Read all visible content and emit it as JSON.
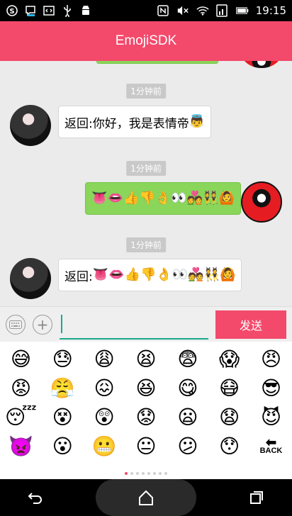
{
  "status_bar": {
    "time": "19:15",
    "left_icons": [
      "s-logo-icon",
      "chat-bubble-icon",
      "code-icon",
      "usb-icon",
      "android-icon"
    ],
    "right_icons": [
      "nfc-icon",
      "mute-icon",
      "wifi-icon",
      "signal-icon",
      "battery-icon"
    ]
  },
  "app_bar": {
    "title": "EmojiSDK"
  },
  "chat": {
    "messages": [
      {
        "timestamp": "1分钟前",
        "direction": "in",
        "text": "返回:你好，我是表情帝",
        "emoji": "👼"
      },
      {
        "timestamp": "1分钟前",
        "direction": "out",
        "text": "",
        "emoji": "👅👄👍👎👌👀💑👯🙆"
      },
      {
        "timestamp": "1分钟前",
        "direction": "in",
        "text": "返回:",
        "emoji": "👅👄👍👎👌👀💑👯🙆"
      }
    ]
  },
  "input": {
    "value": "",
    "send_label": "发送"
  },
  "emoji_panel": {
    "rows": [
      [
        "😅",
        "😓",
        "😩",
        "😫",
        "😨",
        "😱",
        "😠"
      ],
      [
        "😡",
        "😤",
        "😖",
        "😆",
        "😋",
        "😷",
        "😎"
      ],
      [
        "😴",
        "😵",
        "😲",
        "😟",
        "😦",
        "😧",
        "😈"
      ],
      [
        "👿",
        "😮",
        "😬",
        "😐",
        "😕",
        "😯"
      ]
    ],
    "backspace_label": "BACK",
    "page_count": 8,
    "active_page": 0
  },
  "colors": {
    "accent": "#f3496b",
    "bubble_out": "#89d65a"
  }
}
